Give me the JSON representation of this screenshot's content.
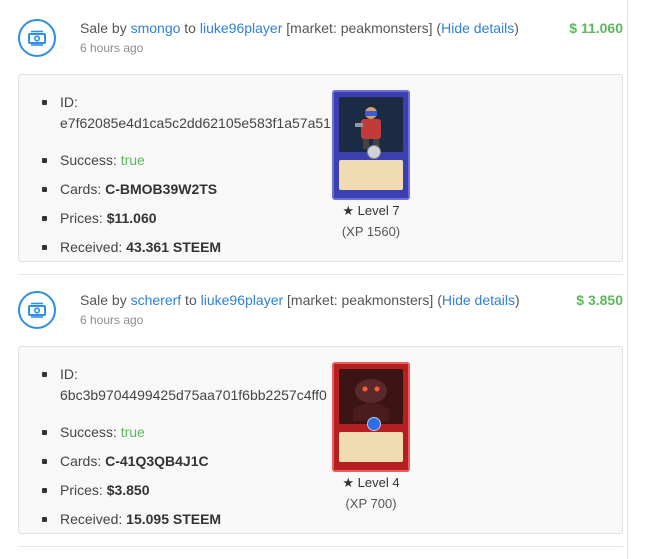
{
  "transactions": [
    {
      "prefix": "Sale by ",
      "seller": "smongo",
      "to_word": " to ",
      "buyer": "liuke96player",
      "market": " [market: peakmonsters] (",
      "toggle": "Hide details",
      "close_paren": ")",
      "time": "6 hours ago",
      "amount": "$ 11.060",
      "details": {
        "id_label": "ID:",
        "id_value": "e7f62085e4d1ca5c2dd62105e583f1a57a51",
        "success_label": "Success: ",
        "success_value": "true",
        "cards_label": "Cards: ",
        "cards_value": "C-BMOB39W2TS",
        "prices_label": "Prices: ",
        "prices_value": "$11.060",
        "received_label": "Received: ",
        "received_value": "43.361 STEEM"
      },
      "card": {
        "level": "Level 7",
        "xp": "(XP 1560)",
        "color": "#3c3fb0"
      }
    },
    {
      "prefix": "Sale by ",
      "seller": "schererf",
      "to_word": " to ",
      "buyer": "liuke96player",
      "market": " [market: peakmonsters] (",
      "toggle": "Hide details",
      "close_paren": ")",
      "time": "6 hours ago",
      "amount": "$ 3.850",
      "details": {
        "id_label": "ID:",
        "id_value": "6bc3b9704499425d75aa701f6bb2257c4ff0",
        "success_label": "Success: ",
        "success_value": "true",
        "cards_label": "Cards: ",
        "cards_value": "C-41Q3QB4J1C",
        "prices_label": "Prices: ",
        "prices_value": "$3.850",
        "received_label": "Received: ",
        "received_value": "15.095 STEEM"
      },
      "card": {
        "level": "Level 4",
        "xp": "(XP 700)",
        "color": "#b51f1f"
      }
    }
  ],
  "icons": {
    "transfer": "money-transfer-icon",
    "level": "star-icon"
  }
}
